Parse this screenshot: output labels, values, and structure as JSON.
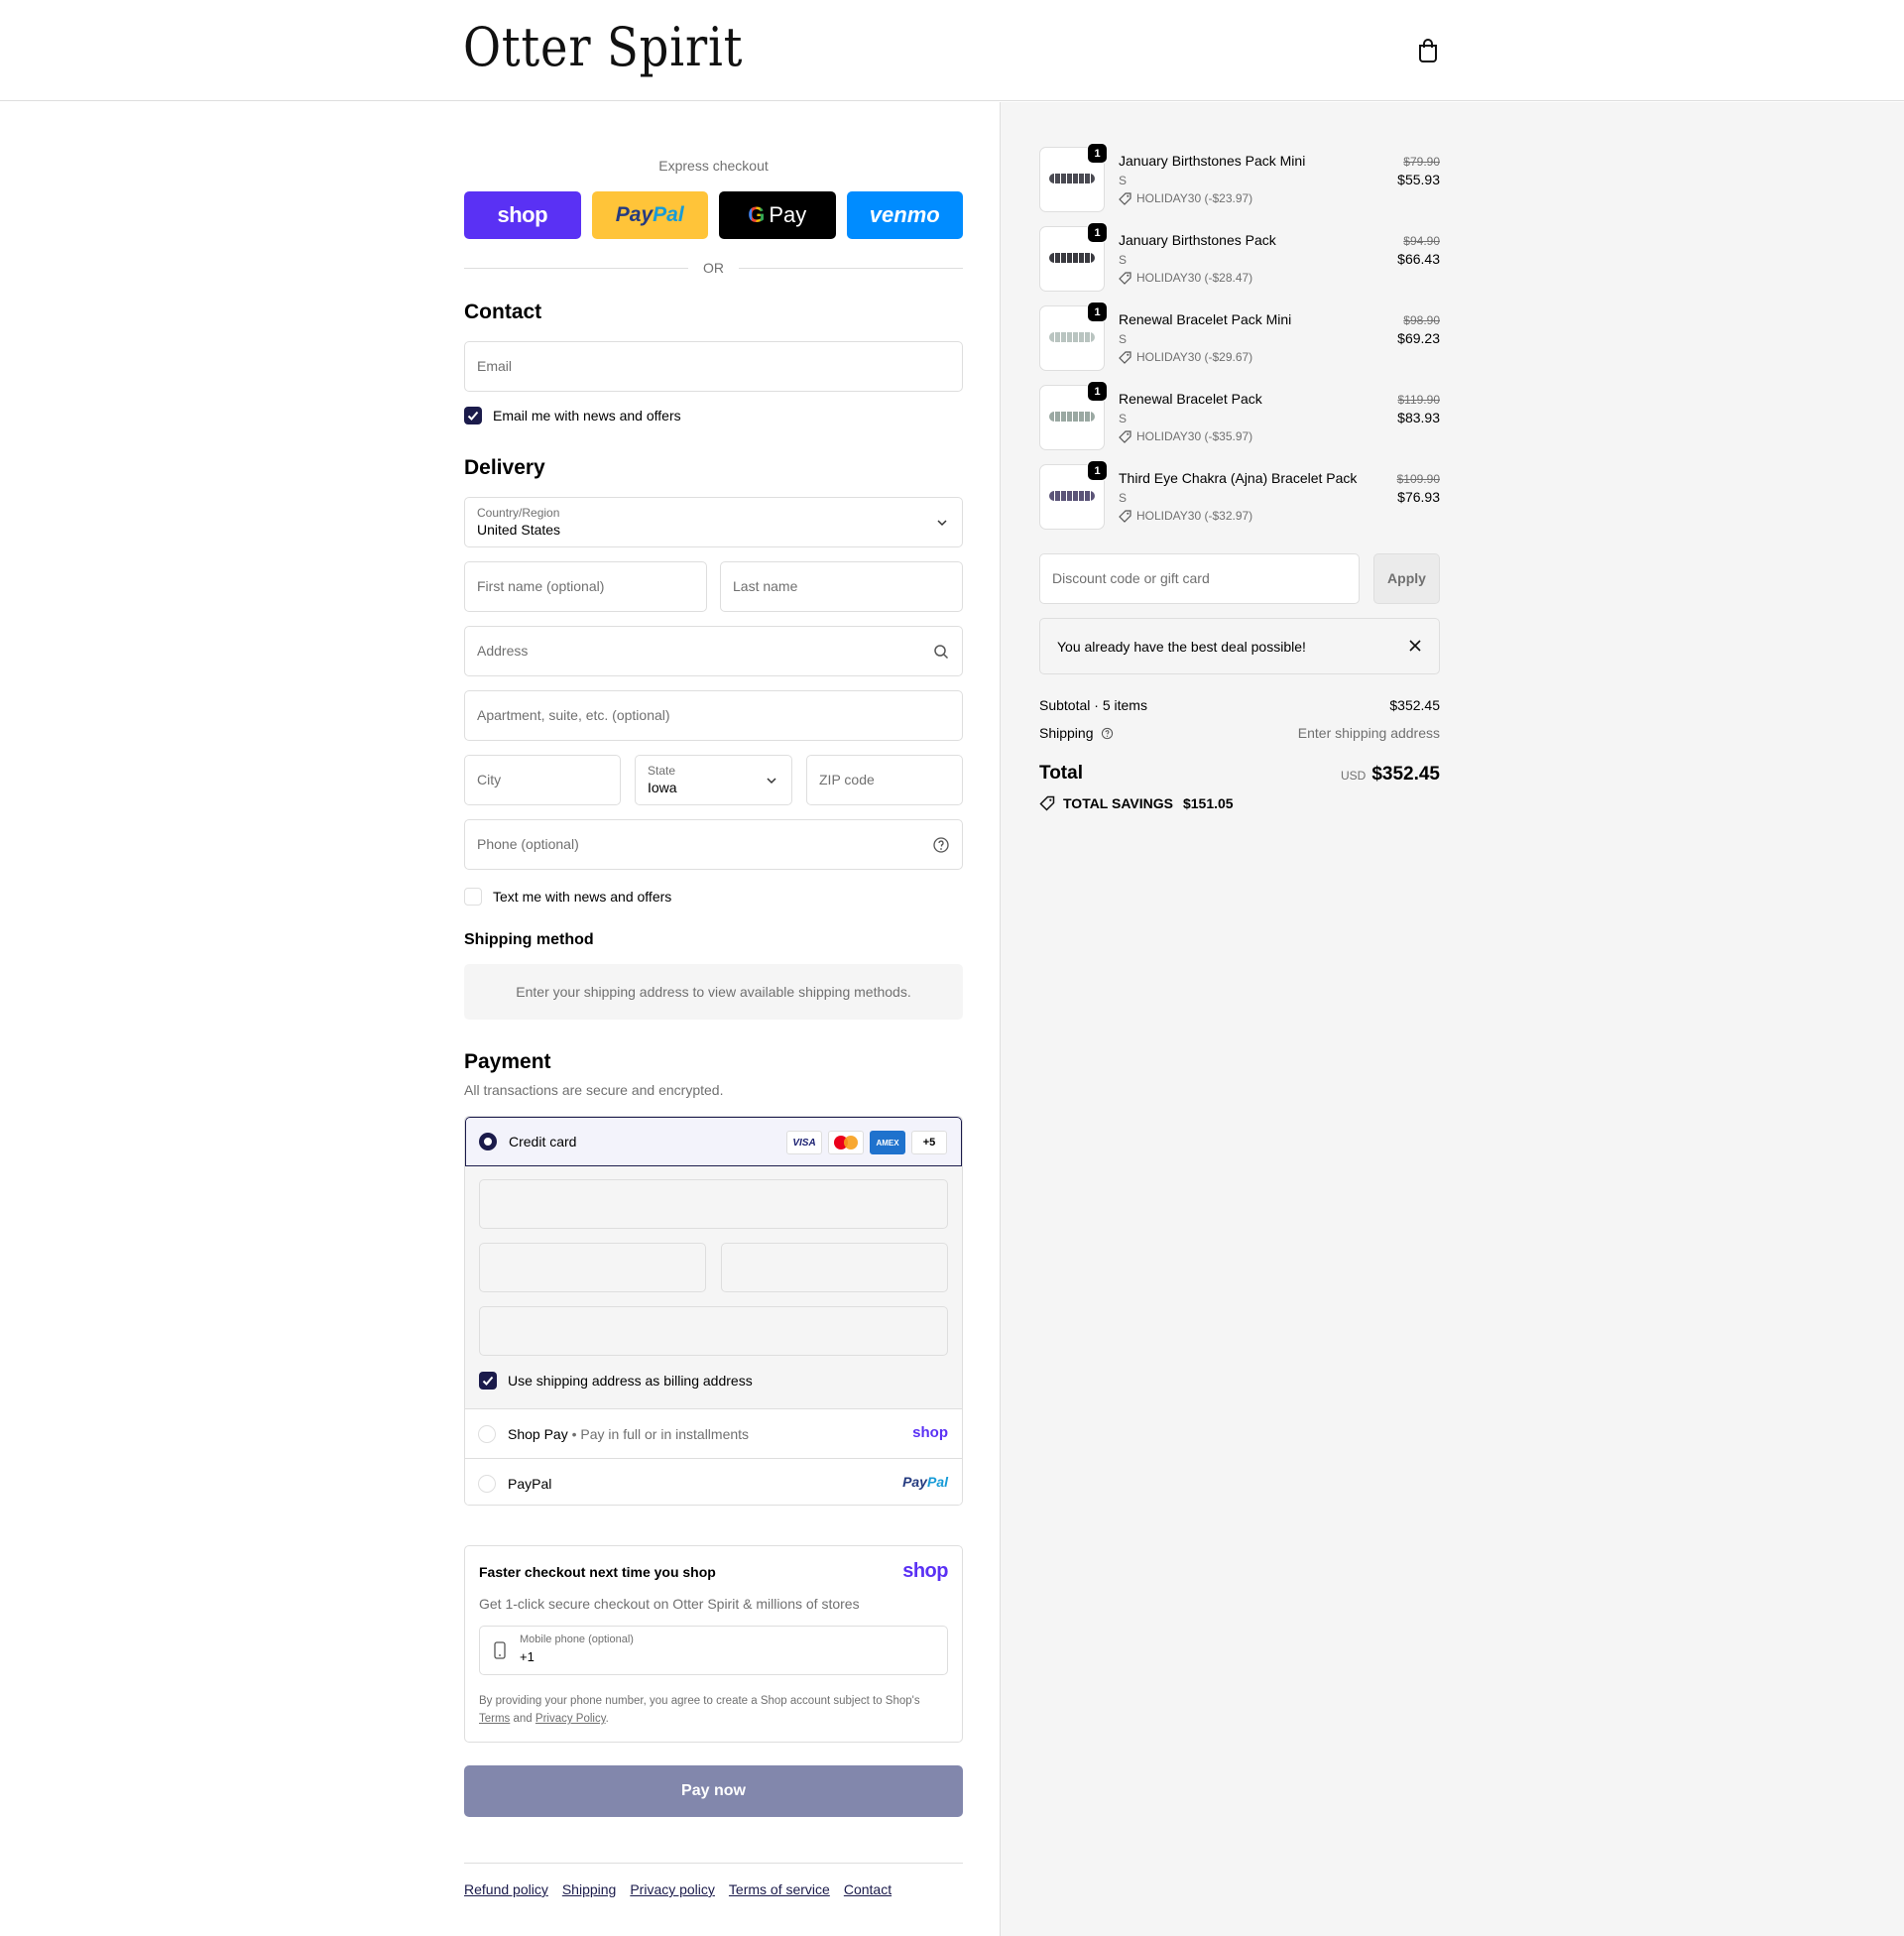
{
  "header": {
    "logo": "Otter Spirit"
  },
  "express": {
    "title": "Express checkout",
    "shop": "shop",
    "paypal_a": "Pay",
    "paypal_b": "Pal",
    "gpay_g": "G",
    "gpay": "Pay",
    "venmo": "venmo",
    "or": "OR"
  },
  "contact": {
    "title": "Contact",
    "email_placeholder": "Email",
    "news_label": "Email me with news and offers"
  },
  "delivery": {
    "title": "Delivery",
    "country_label": "Country/Region",
    "country_value": "United States",
    "first_name": "First name (optional)",
    "last_name": "Last name",
    "address": "Address",
    "apartment": "Apartment, suite, etc. (optional)",
    "city": "City",
    "state_label": "State",
    "state_value": "Iowa",
    "zip": "ZIP code",
    "phone": "Phone (optional)",
    "text_label": "Text me with news and offers"
  },
  "shipping_method": {
    "title": "Shipping method",
    "message": "Enter your shipping address to view available shipping methods."
  },
  "payment": {
    "title": "Payment",
    "subtitle": "All transactions are secure and encrypted.",
    "credit_card": "Credit card",
    "card_visa": "VISA",
    "card_amex": "AMEX",
    "card_more": "+5",
    "billing_label": "Use shipping address as billing address",
    "shop_pay": "Shop Pay",
    "shop_pay_sub": "Pay in full or in installments",
    "shop_brand": "shop",
    "paypal": "PayPal",
    "paypal_brand_a": "Pay",
    "paypal_brand_b": "Pal"
  },
  "faster": {
    "title": "Faster checkout next time you shop",
    "brand": "shop",
    "subtitle": "Get 1-click secure checkout on Otter Spirit & millions of stores",
    "mobile_label": "Mobile phone (optional)",
    "mobile_value": "+1",
    "legal": "By providing your phone number, you agree to create a Shop account subject to Shop's",
    "terms": "Terms",
    "and": "and",
    "privacy": "Privacy Policy"
  },
  "pay_now": "Pay now",
  "footer": {
    "links": [
      "Refund policy",
      "Shipping",
      "Privacy policy",
      "Terms of service",
      "Contact"
    ]
  },
  "summary": {
    "items": [
      {
        "name": "January Birthstones Pack Mini",
        "variant": "S",
        "discount": "HOLIDAY30 (-$23.97)",
        "old_price": "$79.90",
        "price": "$55.93",
        "qty": "1",
        "color": "#4a4a52"
      },
      {
        "name": "January Birthstones Pack",
        "variant": "S",
        "discount": "HOLIDAY30 (-$28.47)",
        "old_price": "$94.90",
        "price": "$66.43",
        "qty": "1",
        "color": "#3a3a40"
      },
      {
        "name": "Renewal Bracelet Pack Mini",
        "variant": "S",
        "discount": "HOLIDAY30 (-$29.67)",
        "old_price": "$98.90",
        "price": "$69.23",
        "qty": "1",
        "color": "#b9c4c0"
      },
      {
        "name": "Renewal Bracelet Pack",
        "variant": "S",
        "discount": "HOLIDAY30 (-$35.97)",
        "old_price": "$119.90",
        "price": "$83.93",
        "qty": "1",
        "color": "#9aa8a2"
      },
      {
        "name": "Third Eye Chakra (Ajna) Bracelet Pack",
        "variant": "S",
        "discount": "HOLIDAY30 (-$32.97)",
        "old_price": "$109.90",
        "price": "$76.93",
        "qty": "1",
        "color": "#5b5478"
      }
    ],
    "discount_placeholder": "Discount code or gift card",
    "apply": "Apply",
    "deal_message": "You already have the best deal possible!",
    "subtotal_label": "Subtotal · 5 items",
    "subtotal_value": "$352.45",
    "shipping_label": "Shipping",
    "shipping_value": "Enter shipping address",
    "total_label": "Total",
    "total_currency": "USD",
    "total_value": "$352.45",
    "savings_label": "TOTAL SAVINGS",
    "savings_value": "$151.05"
  },
  "colors": {
    "accent": "#1b1b4b",
    "shop": "#5a31f4",
    "paypal_yellow": "#ffc439",
    "venmo": "#008cff",
    "pay_now": "#8287ac"
  },
  "icons": [
    "cart-icon",
    "chevron-down-icon",
    "search-icon",
    "help-icon",
    "checkmark-icon",
    "tag-icon",
    "close-icon",
    "phone-icon"
  ]
}
